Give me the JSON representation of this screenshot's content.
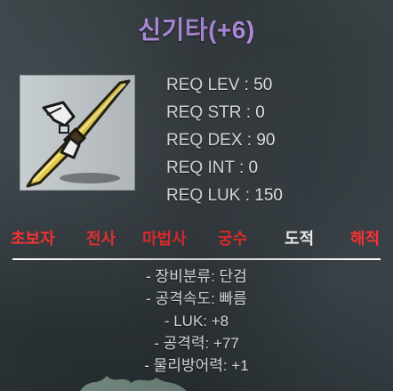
{
  "item": {
    "name": "신기타(+6)",
    "icon": "dagger-item-icon"
  },
  "requirements": [
    "REQ LEV : 50",
    "REQ STR : 0",
    "REQ DEX : 90",
    "REQ INT : 0",
    "REQ LUK : 150"
  ],
  "jobs": [
    {
      "label": "초보자",
      "available": false
    },
    {
      "label": "전사",
      "available": false
    },
    {
      "label": "마법사",
      "available": false
    },
    {
      "label": "궁수",
      "available": false
    },
    {
      "label": "도적",
      "available": true
    },
    {
      "label": "해적",
      "available": false
    }
  ],
  "stats": [
    "- 장비분류: 단검",
    "- 공격속도: 빠름",
    "- LUK: +8",
    "- 공격력: +77",
    "- 물리방어력: +1"
  ],
  "colors": {
    "title": "#c9a0ff",
    "unavailable_job": "#ff3232",
    "available_job": "#ffffff",
    "text": "#ffffff"
  }
}
